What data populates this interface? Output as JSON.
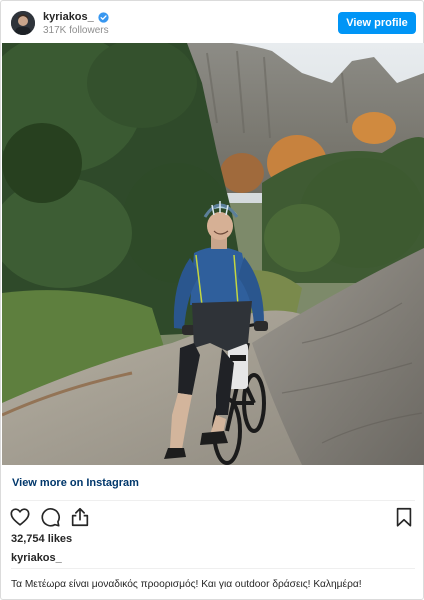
{
  "header": {
    "username": "kyriakos_",
    "followers": "317K followers",
    "view_profile_label": "View profile"
  },
  "post": {
    "view_more_label": "View more on Instagram",
    "likes": "32,754 likes",
    "caption_username": "kyriakos_",
    "caption": "Τα Μετέωρα είναι μοναδικός προορισμός! Και για outdoor δράσεις! Καλημέρα!"
  },
  "icons": {
    "avatar": "avatar",
    "verified": "verified-badge-icon",
    "like": "heart-icon",
    "comment": "comment-bubble-icon",
    "share": "share-icon",
    "save": "bookmark-icon"
  },
  "colors": {
    "accent": "#0095f6",
    "link": "#00376b",
    "secondary_text": "#8e8e8e",
    "border": "#dbdbdb"
  }
}
